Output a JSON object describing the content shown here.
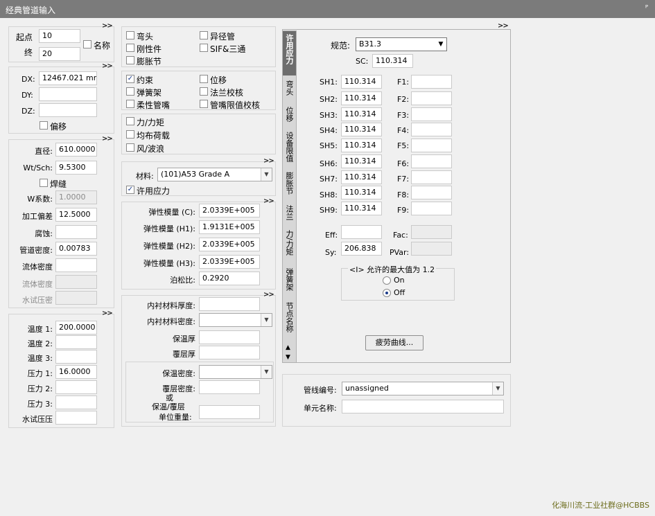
{
  "window": {
    "title": "经典管道输入",
    "pin_glyph": "ᴾ"
  },
  "collapse_glyph": ">>",
  "nodes": {
    "from_label": "起点",
    "to_label": "终",
    "from_value": "10",
    "to_value": "20",
    "name_label": "名称",
    "name_checked": false
  },
  "deltas": {
    "dx_label": "DX:",
    "dx_value": "12467.021 mm",
    "dy_label": "DY:",
    "dy_value": "",
    "dz_label": "DZ:",
    "dz_value": "",
    "offset_label": "偏移",
    "offset_checked": false
  },
  "pipe": {
    "diameter_label": "直径:",
    "diameter_value": "610.0000",
    "wt_label": "Wt/Sch:",
    "wt_value": "9.5300",
    "weld_label": "焊缝",
    "wi_label": "W系数:",
    "wi_value": "1.0000",
    "mill_label": "加工偏差",
    "mill_value": "12.5000",
    "corr_label": "腐蚀:",
    "corr_value": "",
    "pipe_density_label": "管道密度:",
    "pipe_density_value": "0.00783",
    "fluid_density_label": "流体密度",
    "fluid_density_value": "",
    "fluid_density2_label": "流体密度",
    "hydro_density_label": "水试压密"
  },
  "temps": {
    "t1_label": "温度 1:",
    "t1_value": "200.0000",
    "t2_label": "温度 2:",
    "t3_label": "温度 3:",
    "p1_label": "压力 1:",
    "p1_value": "16.0000",
    "p2_label": "压力 2:",
    "p3_label": "压力 3:",
    "hydro_label": "水试压压"
  },
  "elements": {
    "bend": "弯头",
    "reducer": "异径管",
    "rigid": "刚性件",
    "sif": "SIF&三通",
    "expansion": "膨胀节",
    "restraint": "约束",
    "displacement": "位移",
    "hanger": "弹簧架",
    "flange": "法兰校核",
    "flex_nozzle": "柔性管嘴",
    "nozzle_limit": "管嘴限值校核",
    "force": "力/力矩",
    "uniform": "均布荷载",
    "wind": "风/波浪"
  },
  "material": {
    "label": "材料:",
    "value": "(101)A53 Grade A",
    "allow_label": "许用应力"
  },
  "elastic": {
    "ec_label": "弹性模量 (C):",
    "ec_value": "2.0339E+005",
    "eh1_label": "弹性模量 (H1):",
    "eh1_value": "1.9131E+005",
    "eh2_label": "弹性模量 (H2):",
    "eh2_value": "2.0339E+005",
    "eh3_label": "弹性模量 (H3):",
    "eh3_value": "2.0339E+005",
    "poisson_label": "泊松比:",
    "poisson_value": "0.2920"
  },
  "lining": {
    "thk_label": "内衬材料厚度:",
    "dens_label": "内衬材料密度:",
    "ins_thk_label": "保温厚",
    "clad_thk_label": "覆层厚",
    "ins_dens_label": "保温密度:",
    "clad_dens_label": "覆层密度:",
    "or_label": "或",
    "ins_clad_label": "保温/覆层",
    "unit_wt_label": "单位重量:"
  },
  "vtabs": [
    "许用应力",
    "弯头",
    "位移",
    "设备限值",
    "膨胀节",
    "法兰",
    "力/力矩",
    "弹簧架",
    "节点名称"
  ],
  "allowable": {
    "code_label": "规范:",
    "code_value": "B31.3",
    "sc_label": "SC:",
    "sc_value": "110.314",
    "sh_labels": [
      "SH1:",
      "SH2:",
      "SH3:",
      "SH4:",
      "SH5:",
      "SH6:",
      "SH7:",
      "SH8:",
      "SH9:"
    ],
    "sh_values": [
      "110.314",
      "110.314",
      "110.314",
      "110.314",
      "110.314",
      "110.314",
      "110.314",
      "110.314",
      "110.314"
    ],
    "f_labels": [
      "F1:",
      "F2:",
      "F3:",
      "F4:",
      "F5:",
      "F6:",
      "F7:",
      "F8:",
      "F9:"
    ],
    "eff_label": "Eff:",
    "sy_label": "Sy:",
    "sy_value": "206.838",
    "fac_label": "Fac:",
    "pvar_label": "PVar:",
    "max_title": "<I> 允许的最大值为 1.2",
    "on_label": "On",
    "off_label": "Off",
    "fatigue_button": "疲劳曲线..."
  },
  "line": {
    "number_label": "管线编号:",
    "number_value": "unassigned",
    "elem_label": "单元名称:",
    "elem_value": ""
  },
  "watermark": "化海川流-工业社群@HCBBS"
}
